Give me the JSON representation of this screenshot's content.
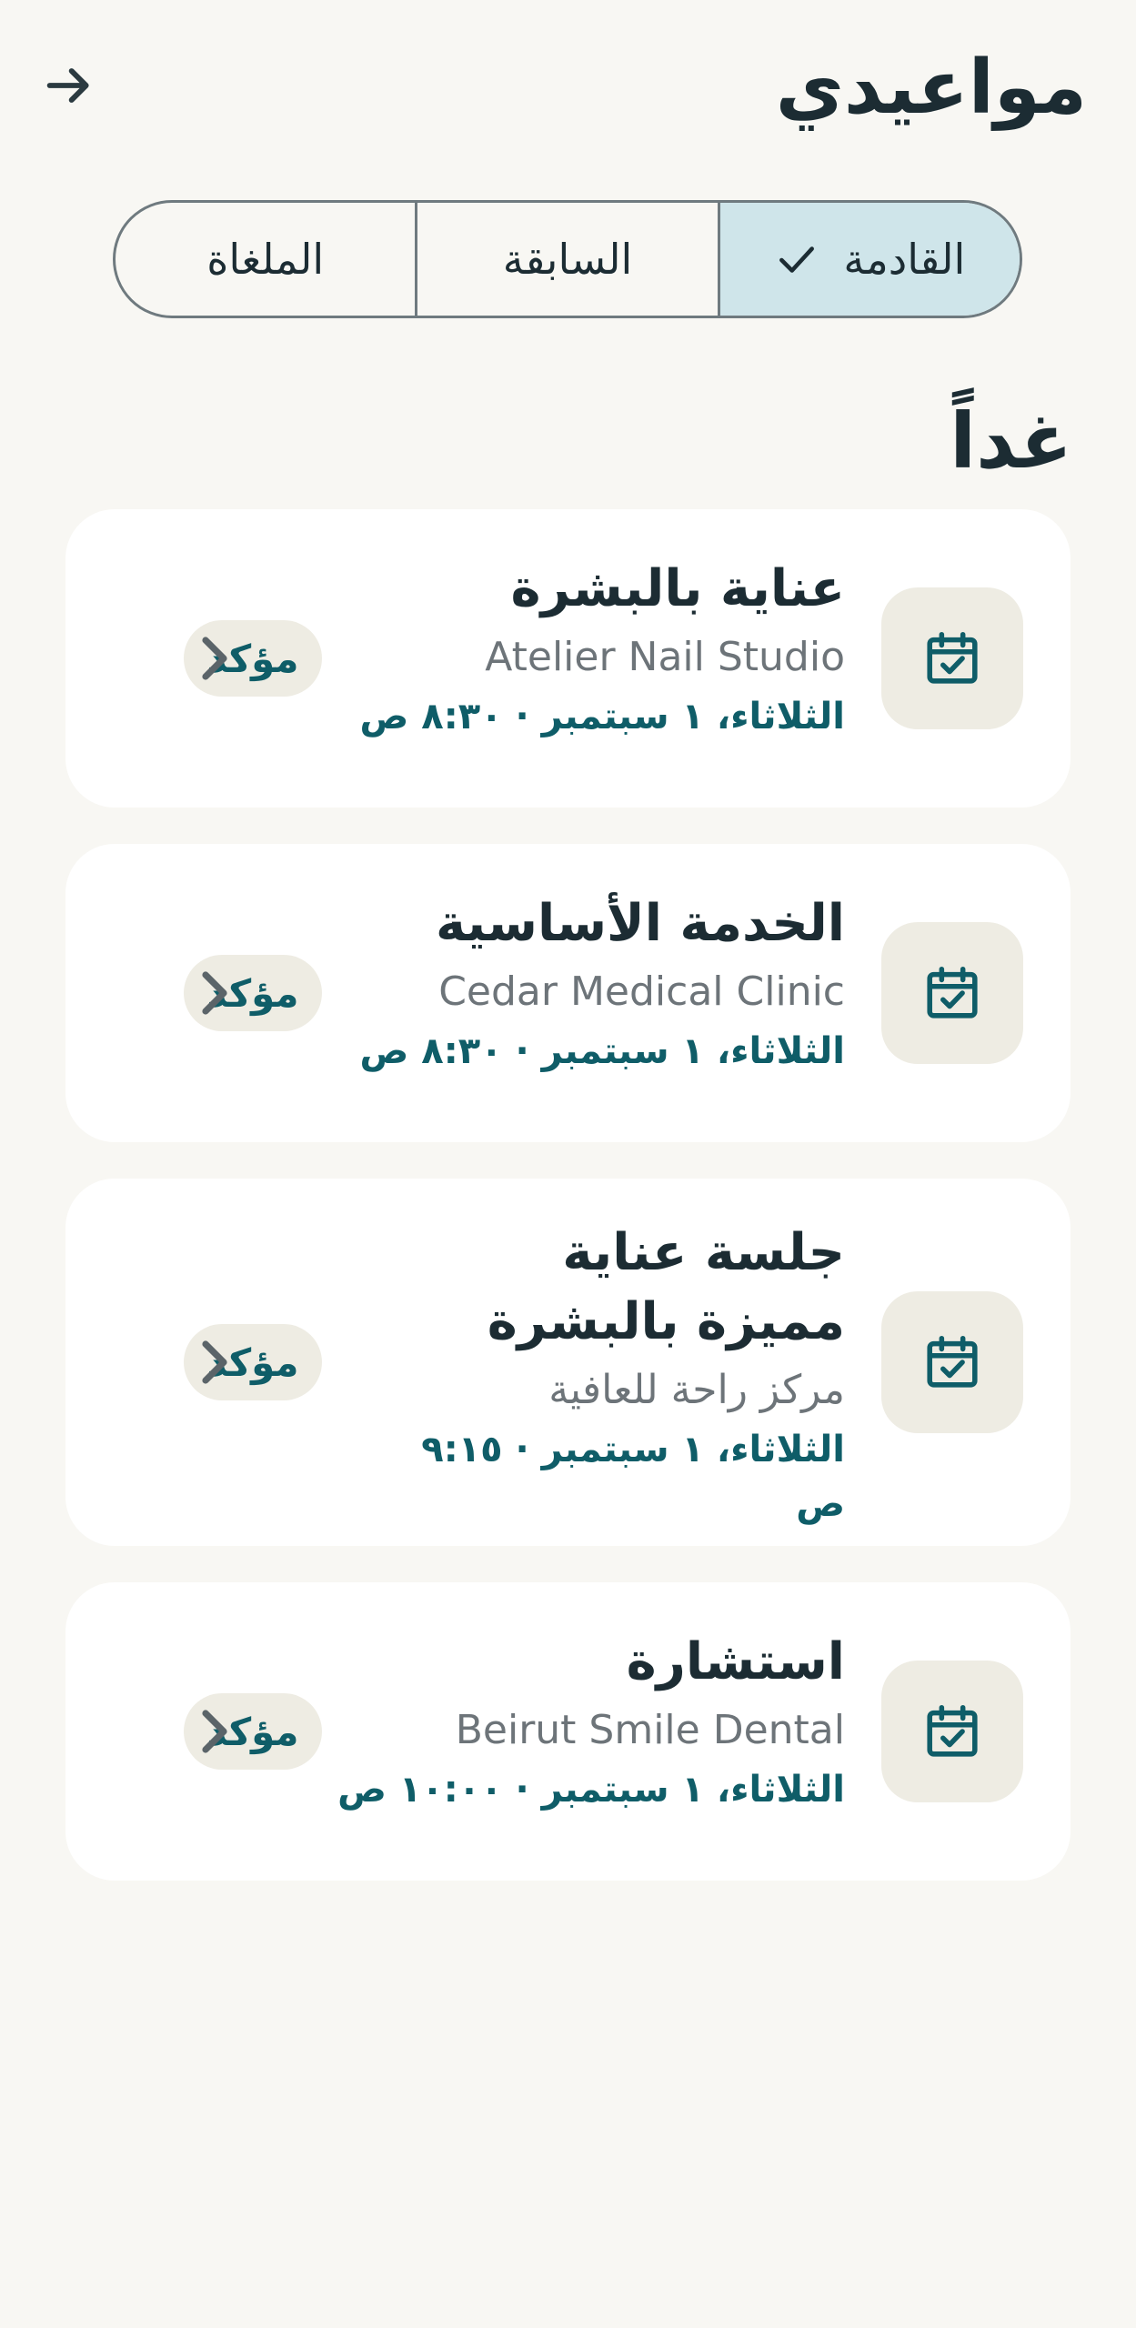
{
  "header": {
    "title": "مواعيدي",
    "back_icon": "arrow-right-icon"
  },
  "tabs": [
    {
      "label": "القادمة",
      "active": true,
      "icon": "check-icon"
    },
    {
      "label": "السابقة",
      "active": false
    },
    {
      "label": "الملغاة",
      "active": false
    }
  ],
  "section": {
    "title": "غداً"
  },
  "appointments": [
    {
      "title": "عناية بالبشرة",
      "venue": "Atelier Nail Studio",
      "when": "الثلاثاء، ١ سبتمبر · ٨:٣٠ ص",
      "status": "مؤكد",
      "icon": "calendar-check-icon"
    },
    {
      "title": "الخدمة الأساسية",
      "venue": "Cedar Medical Clinic",
      "when": "الثلاثاء، ١ سبتمبر · ٨:٣٠ ص",
      "status": "مؤكد",
      "icon": "calendar-check-icon"
    },
    {
      "title": "جلسة عناية مميزة بالبشرة",
      "venue": "مركز راحة للعافية",
      "when": "الثلاثاء، ١ سبتمبر · ٩:١٥ ص",
      "status": "مؤكد",
      "icon": "calendar-check-icon"
    },
    {
      "title": "استشارة",
      "venue": "Beirut Smile Dental",
      "when": "الثلاثاء، ١ سبتمبر · ١٠:٠٠ ص",
      "status": "مؤكد",
      "icon": "calendar-check-icon"
    }
  ],
  "colors": {
    "background": "#f8f7f3",
    "card": "#ffffff",
    "accent": "#0f5d68",
    "active_tab": "#cfe5ea",
    "badge_bg": "#eeece3"
  }
}
